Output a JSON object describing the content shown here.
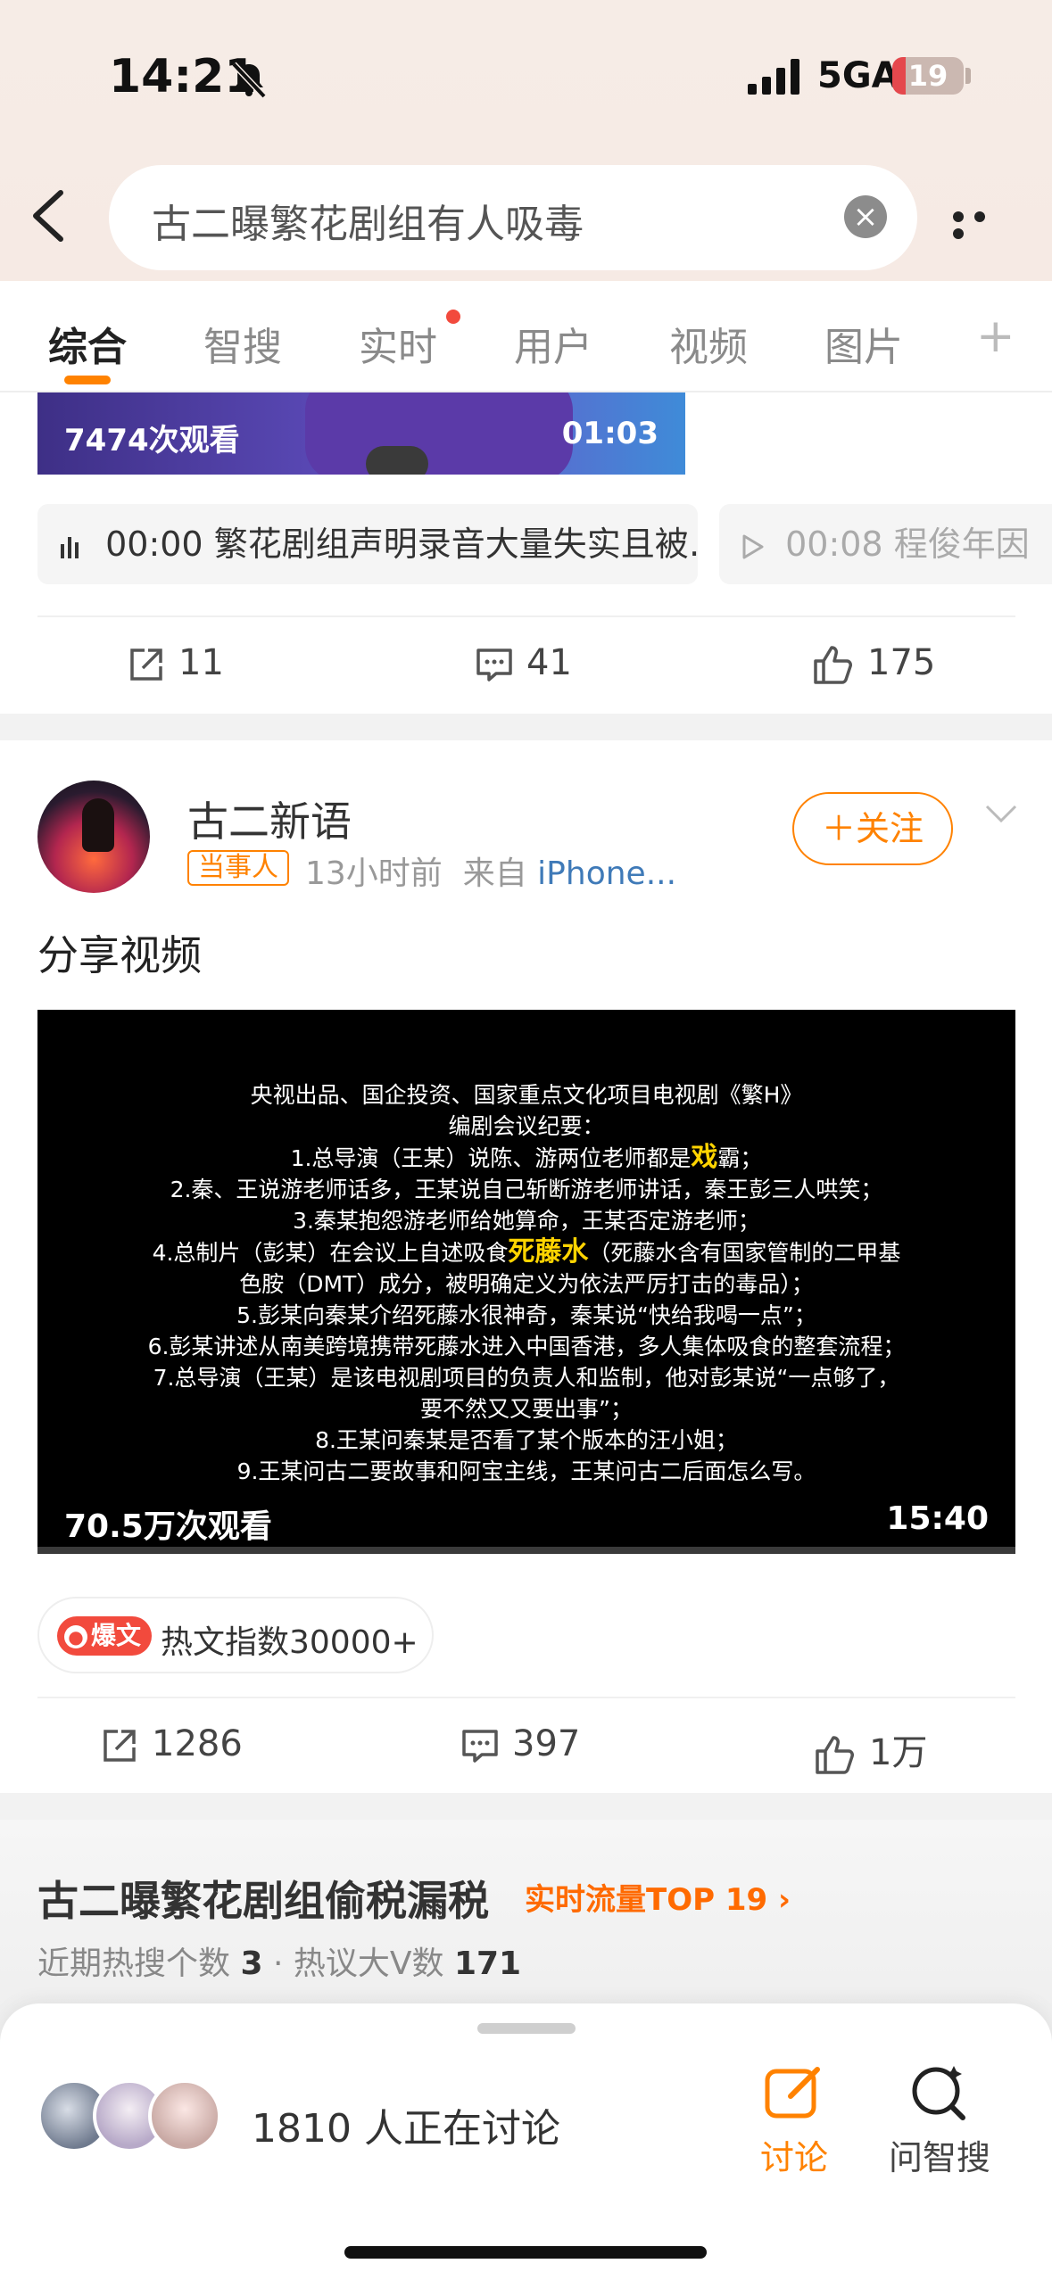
{
  "status_bar": {
    "time": "14:21",
    "network": "5GA",
    "battery": "19",
    "battery_level": 0.19
  },
  "search": {
    "query": "古二曝繁花剧组有人吸毒"
  },
  "tabs": [
    {
      "label": "综合",
      "active": true
    },
    {
      "label": "智搜"
    },
    {
      "label": "实时",
      "dot": true
    },
    {
      "label": "用户"
    },
    {
      "label": "视频"
    },
    {
      "label": "图片"
    }
  ],
  "tab_add": "+",
  "post1": {
    "views": "7474次观看",
    "duration": "01:03",
    "audio_chips": [
      {
        "time": "00:00",
        "text": "繁花剧组声明录音大量失实且被…"
      },
      {
        "time": "00:08",
        "text": "程俊年因"
      }
    ],
    "actions": {
      "share": "11",
      "comment": "41",
      "like": "175"
    }
  },
  "post2": {
    "username": "古二新语",
    "badge": "当事人",
    "time": "13小时前",
    "source_prefix": "来自",
    "source": "iPhone...",
    "follow_label": "＋关注",
    "text": "分享视频",
    "video_lines": [
      {
        "text": "央视出品、国企投资、国家重点文化项目电视剧《繁H》"
      },
      {
        "text": "编剧会议纪要："
      },
      {
        "pre": "1.总导演（王某）说陈、游两位老师都是",
        "hl": "戏",
        "post": "霸；"
      },
      {
        "text": "2.秦、王说游老师话多，王某说自己斩断游老师讲话，秦王彭三人哄笑；"
      },
      {
        "text": "3.秦某抱怨游老师给她算命，王某否定游老师；"
      },
      {
        "pre": "4.总制片（彭某）在会议上自述吸食",
        "hl": "死藤水",
        "post": "（死藤水含有国家管制的二甲基"
      },
      {
        "text": "色胺（DMT）成分，被明确定义为依法严厉打击的毒品）；"
      },
      {
        "text": "5.彭某向秦某介绍死藤水很神奇，秦某说“快给我喝一点”；"
      },
      {
        "text": "6.彭某讲述从南美跨境携带死藤水进入中国香港，多人集体吸食的整套流程；"
      },
      {
        "text": "7.总导演（王某）是该电视剧项目的负责人和监制，他对彭某说“一点够了，"
      },
      {
        "text": "要不然又又要出事”；"
      },
      {
        "text": "8.王某问秦某是否看了某个版本的汪小姐；"
      },
      {
        "text": "9.王某问古二要故事和阿宝主线，王某问古二后面怎么写。"
      }
    ],
    "views": "70.5万次观看",
    "duration": "15:40",
    "hot_tag": "爆文",
    "hot_text": "热文指数30000+",
    "actions": {
      "share": "1286",
      "comment": "397",
      "like": "1万"
    }
  },
  "trend": {
    "title": "古二曝繁花剧组偷税漏税",
    "rank": "实时流量TOP 19 ›",
    "sub_prefix": "近期热搜个数",
    "sub_count": "3",
    "sub_mid": "· 热议大V数",
    "sub_vcount": "171"
  },
  "bottom_sheet": {
    "discussing": "1810 人正在讨论",
    "discuss_label": "讨论",
    "ask_label": "问智搜"
  },
  "colors": {
    "accent": "#ff8200",
    "hot_red": "#f24a3d",
    "link_blue": "#3f7ab8"
  }
}
